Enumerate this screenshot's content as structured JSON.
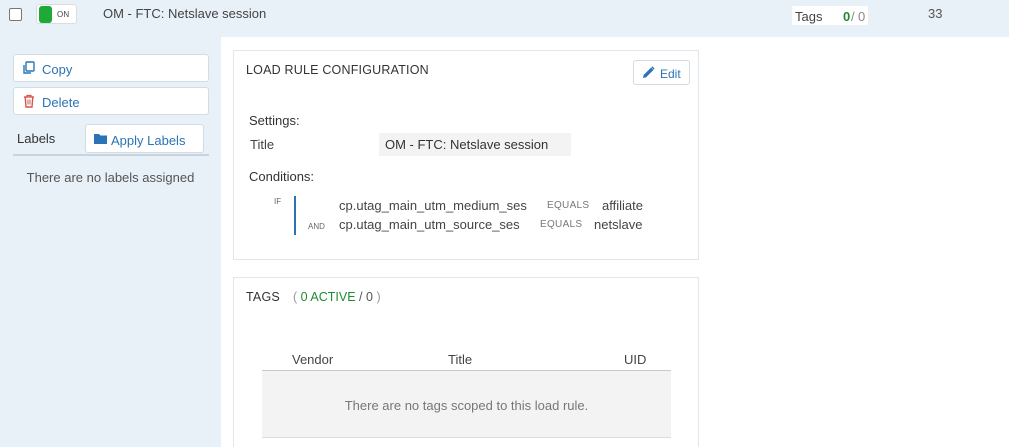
{
  "header": {
    "toggle_state": "ON",
    "rule_title": "OM - FTC: Netslave session",
    "tags_label": "Tags",
    "tags_active": "0",
    "tags_separator": "/",
    "tags_total": "0",
    "rule_uid": "33"
  },
  "sidebar": {
    "copy_label": "Copy",
    "delete_label": "Delete",
    "labels_caption": "Labels",
    "apply_labels_label": "Apply Labels",
    "no_labels_text": "There are no labels assigned"
  },
  "load_rule_config": {
    "title": "LOAD RULE CONFIGURATION",
    "edit_label": "Edit",
    "settings_heading": "Settings:",
    "title_field_label": "Title",
    "title_field_value": "OM - FTC: Netslave session",
    "conditions_heading": "Conditions:",
    "conditions": [
      {
        "prefix": "IF",
        "variable": "cp.utag_main_utm_medium_ses",
        "operator": "EQUALS",
        "value": "affiliate"
      },
      {
        "prefix": "AND",
        "variable": "cp.utag_main_utm_source_ses",
        "operator": "EQUALS",
        "value": "netslave"
      }
    ]
  },
  "tags_section": {
    "title": "TAGS",
    "open_paren": "(",
    "active_text": "0 ACTIVE",
    "separator": "/",
    "total": "0",
    "close_paren": ")",
    "columns": [
      "Vendor",
      "Title",
      "UID"
    ],
    "empty_message": "There are no tags scoped to this load rule."
  },
  "colors": {
    "header_bg": "#e8f0f8",
    "accent_blue": "#2a74b6",
    "active_green": "#1e8a32",
    "delete_red": "#d9534f"
  },
  "icons": {
    "copy": "copy-icon",
    "delete": "trash-icon",
    "apply_labels": "folder-icon",
    "edit": "pencil-icon"
  }
}
